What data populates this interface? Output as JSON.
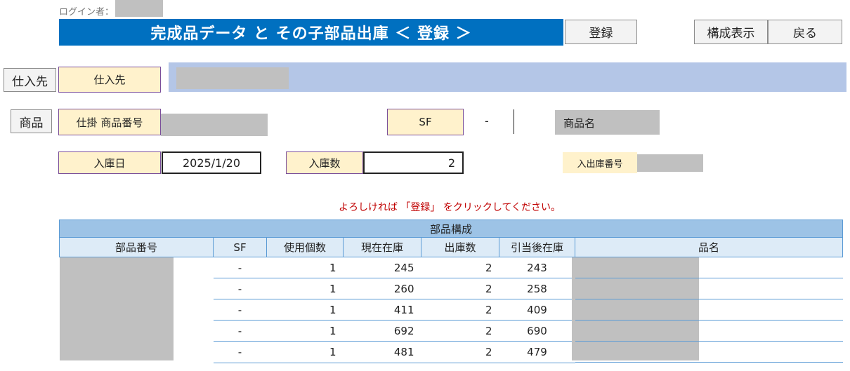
{
  "header": {
    "login_label": "ログイン者：",
    "title": "完成品データ と その子部品出庫 ＜ 登録 ＞",
    "register_button": "登録",
    "show_structure_button": "構成表示",
    "back_button": "戻る"
  },
  "supplier": {
    "button": "仕入先",
    "label": "仕入先"
  },
  "product": {
    "button": "商品",
    "wip_label": "仕掛 商品番号",
    "sf_label": "SF",
    "sf_value": "-",
    "name_label": "商品名"
  },
  "receipt": {
    "date_label": "入庫日",
    "date_value": "2025/1/20",
    "qty_label": "入庫数",
    "qty_value": "2",
    "io_number_label": "入出庫番号"
  },
  "message": "よろしければ 「登録」 をクリックしてください。",
  "table": {
    "caption": "部品構成",
    "columns": [
      "部品番号",
      "SF",
      "使用個数",
      "現在在庫",
      "出庫数",
      "引当後在庫",
      "品名"
    ],
    "rows": [
      {
        "sf": "-",
        "use_qty": "1",
        "stock": "245",
        "out_qty": "2",
        "after": "243"
      },
      {
        "sf": "-",
        "use_qty": "1",
        "stock": "260",
        "out_qty": "2",
        "after": "258"
      },
      {
        "sf": "-",
        "use_qty": "1",
        "stock": "411",
        "out_qty": "2",
        "after": "409"
      },
      {
        "sf": "-",
        "use_qty": "1",
        "stock": "692",
        "out_qty": "2",
        "after": "690"
      },
      {
        "sf": "-",
        "use_qty": "1",
        "stock": "481",
        "out_qty": "2",
        "after": "479"
      }
    ]
  },
  "colors": {
    "title_bg": "#0070c0",
    "label_bg": "#fff2cc",
    "supplier_bar": "#b4c6e7",
    "message": "#c00000",
    "table_header": "#ddebf7",
    "table_caption": "#9dc3e6",
    "redacted": "#c0c0c0"
  }
}
